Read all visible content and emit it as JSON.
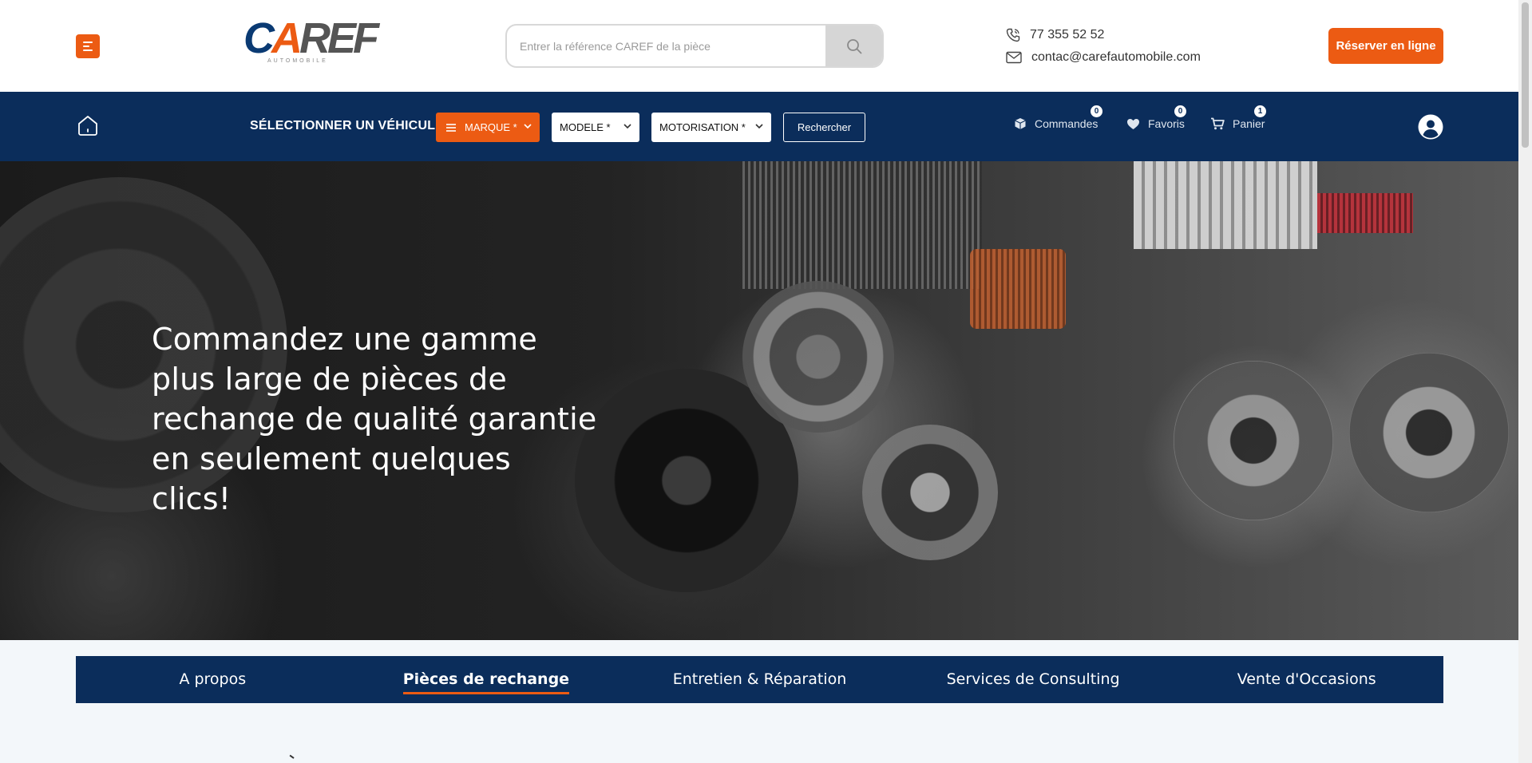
{
  "header": {
    "logo_text_c": "C",
    "logo_text_a": "A",
    "logo_text_rest": "REF",
    "logo_sub": "AUTOMOBILE",
    "search_placeholder": "Entrer la référence CAREF de la pièce",
    "phone": "77 355 52 52",
    "email": "contac@carefautomobile.com",
    "reserve_label": "Réserver en ligne"
  },
  "navbar": {
    "select_label": "SÉLECTIONNER UN VÉHICULE",
    "marque_label": "MARQUE *",
    "modele_label": "MODELE *",
    "motorisation_label": "MOTORISATION *",
    "search_label": "Rechercher",
    "links": {
      "commandes": {
        "label": "Commandes",
        "count": "0"
      },
      "favoris": {
        "label": "Favoris",
        "count": "0"
      },
      "panier": {
        "label": "Panier",
        "count": "1"
      }
    }
  },
  "hero": {
    "line1": "Commandez une gamme",
    "line2": "plus large de pièces de",
    "line3": "rechange de qualité garantie",
    "line4": "en seulement quelques clics!"
  },
  "tabs": [
    {
      "label": "A propos",
      "active": false
    },
    {
      "label": "Pièces de rechange",
      "active": true
    },
    {
      "label": "Entretien & Réparation",
      "active": false
    },
    {
      "label": "Services de Consulting",
      "active": false
    },
    {
      "label": "Vente d'Occasions",
      "active": false
    }
  ],
  "colors": {
    "accent": "#ec5b13",
    "navy": "#0b2d5b",
    "page_bg": "#f3f7fa"
  },
  "icons": {
    "menu": "hamburger-icon",
    "search": "search-icon",
    "phone": "phone-icon",
    "email": "mail-icon",
    "home": "home-icon",
    "orders": "box-icon",
    "favorites": "heart-icon",
    "cart": "cart-icon",
    "user": "user-icon"
  }
}
